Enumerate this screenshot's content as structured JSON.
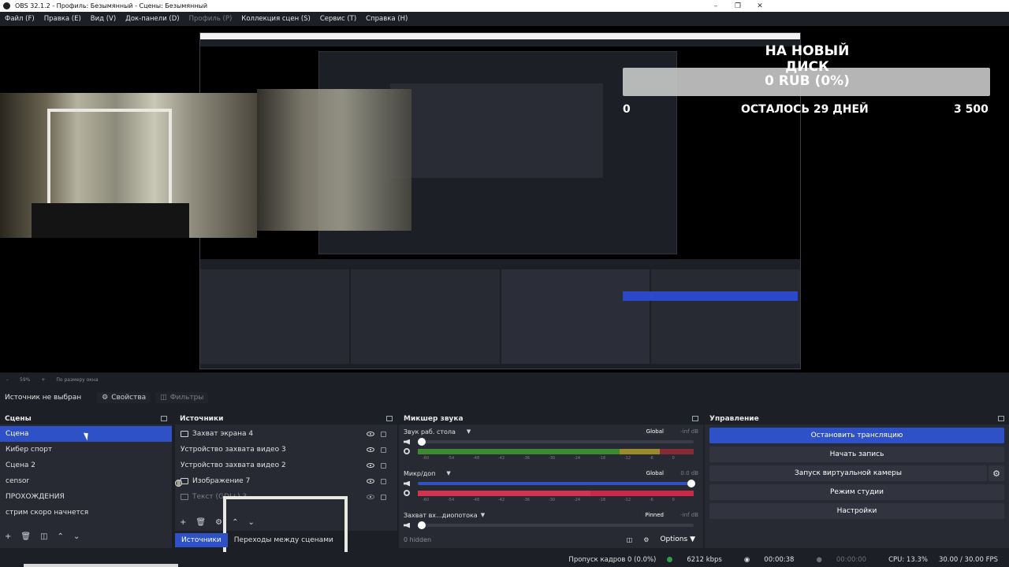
{
  "window": {
    "title": "OBS 32.1.2 - Профиль: Безымянный - Сцены: Безымянный",
    "controls": [
      "–",
      "❐",
      "✕"
    ]
  },
  "menu": [
    {
      "label": "Файл (F)",
      "enabled": true
    },
    {
      "label": "Правка (E)",
      "enabled": true
    },
    {
      "label": "Вид (V)",
      "enabled": true
    },
    {
      "label": "Док-панели (D)",
      "enabled": true
    },
    {
      "label": "Профиль (P)",
      "enabled": false
    },
    {
      "label": "Коллекция сцен (S)",
      "enabled": true
    },
    {
      "label": "Сервис (T)",
      "enabled": true
    },
    {
      "label": "Справка (H)",
      "enabled": true
    }
  ],
  "overlay": {
    "title": "НА НОВЫЙ ДИСК",
    "amount": "0 RUB (0%)",
    "start": "0",
    "remaining": "ОСТАЛОСЬ 29 ДНЕЙ",
    "goal": "3 500"
  },
  "zoombar": {
    "minus": "–",
    "zoom": "59%",
    "plus": "+",
    "fit": "По размеру окна"
  },
  "source_toolbar": {
    "label": "Источник не выбран",
    "properties": "Свойства",
    "filters": "Фильтры"
  },
  "scenes": {
    "title": "Сцены",
    "items": [
      "Сцена",
      "Кибер спорт",
      "Сцена 2",
      "censor",
      "ПРОХОЖДЕНИЯ",
      "стрим скоро начнется"
    ],
    "selected_index": 0
  },
  "sources": {
    "title": "Источники",
    "items": [
      {
        "label": "Захват экрана 4",
        "icon": "monitor-icon",
        "visible": true
      },
      {
        "label": "Устройство захвата видео 3",
        "icon": "camera-icon",
        "visible": true
      },
      {
        "label": "Устройство захвата видео 2",
        "icon": "camera-icon",
        "visible": true
      },
      {
        "label": "Изображение 7",
        "icon": "image-icon",
        "visible": true
      },
      {
        "label": "Текст (GDI+) 3",
        "icon": "text-icon",
        "visible": false
      }
    ]
  },
  "tabs": {
    "sources": "Источники",
    "transitions": "Переходы между сценами"
  },
  "mixer": {
    "title": "Микшер звука",
    "channels": [
      {
        "name": "Звук раб. стола",
        "tag": "Global",
        "db": "-inf dB",
        "volume": 0.0
      },
      {
        "name": "Микр/доп",
        "tag": "Global",
        "db": "0.0 dB",
        "volume": 1.0
      },
      {
        "name": "Захват вх...диопотока",
        "tag": "Pinned",
        "db": "-inf dB",
        "volume": 0.0
      }
    ],
    "scale": [
      "-60",
      "-54",
      "-48",
      "-42",
      "-36",
      "-30",
      "-24",
      "-18",
      "-12",
      "-6",
      "0"
    ],
    "hidden": "0 hidden",
    "options": "Options"
  },
  "controls": {
    "title": "Управление",
    "stop_stream": "Остановить трансляцию",
    "start_record": "Начать запись",
    "virtual_cam": "Запуск виртуальной камеры",
    "studio_mode": "Режим студии",
    "settings": "Настройки"
  },
  "status": {
    "dropped": "Пропуск кадров 0 (0.0%)",
    "bitrate": "6212 kbps",
    "stream_time": "00:00:38",
    "record_time": "00:00:00",
    "cpu": "CPU: 13.3%",
    "fps": "30.00 / 30.00 FPS"
  },
  "colors": {
    "accent": "#2f51c7",
    "bg": "#1d1f26",
    "dock": "#272a33",
    "live": "#2f9e44"
  }
}
